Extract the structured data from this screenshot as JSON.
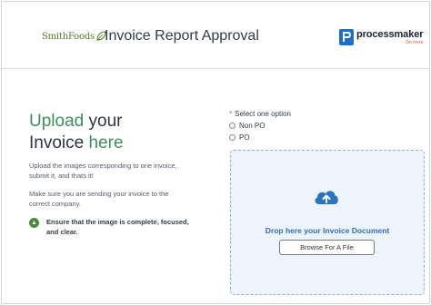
{
  "header": {
    "brand_left": "SmithFoods",
    "title": "Invoice Report Approval",
    "brand_right": {
      "name": "processmaker",
      "tagline": "Do more"
    }
  },
  "left": {
    "hero_part1": "Upload",
    "hero_part2": " your",
    "hero_part3": "Invoice ",
    "hero_part4": "here",
    "paragraph1": "Upload the images corresponding to one invoice, submit it, and thats it!",
    "paragraph2": "Make sure you are sending your invoice to the correct company.",
    "tip": "Ensure that the image is complete, focused, and clear."
  },
  "form": {
    "required_label": "Select one option",
    "options": [
      "Non PO",
      "PO"
    ],
    "selected": null
  },
  "upload": {
    "drop_text": "Drop here your Invoice Document",
    "browse_label": "Browse For A File"
  },
  "colors": {
    "accent_green": "#3f8f5a",
    "accent_blue": "#2f6fb5",
    "dropzone_bg": "#eef4fb",
    "pm_orange": "#e4572e"
  },
  "icons": [
    "leaf-icon",
    "processmaker-logo-icon",
    "tip-icon",
    "cloud-upload-icon"
  ]
}
